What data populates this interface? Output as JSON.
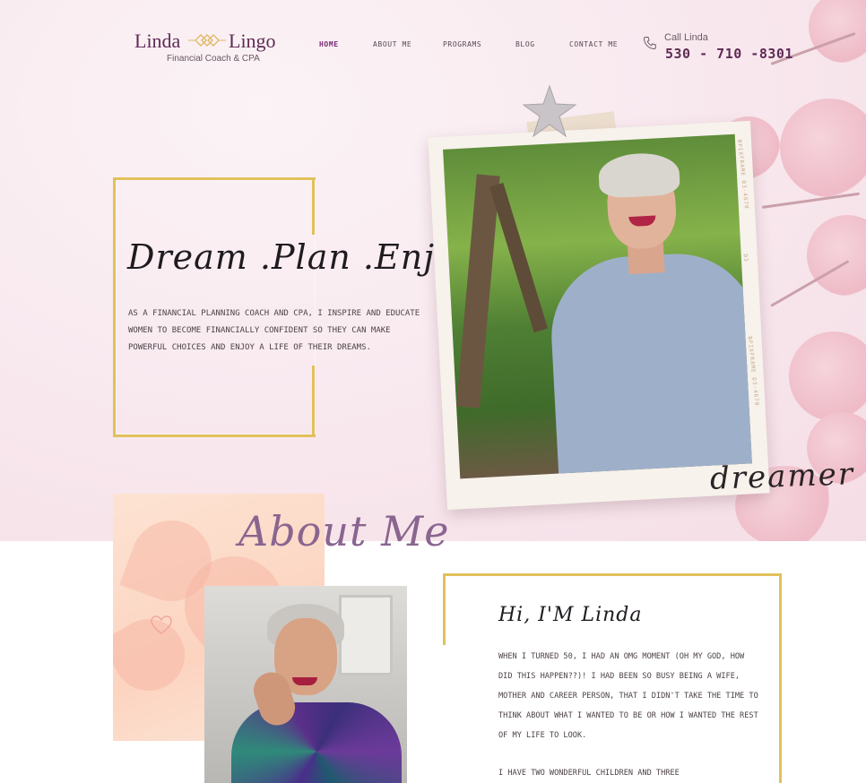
{
  "brand": {
    "name_first": "Linda",
    "name_last": "Lingo",
    "subtitle": "Financial Coach & CPA",
    "logo_icon": "interlocking-diamonds-icon",
    "accent_color": "#5e2b55",
    "gold_color": "#e2c15c"
  },
  "nav": {
    "items": [
      {
        "label": "HOME",
        "active": true
      },
      {
        "label": "ABOUT ME",
        "active": false
      },
      {
        "label": "PROGRAMS",
        "active": false
      },
      {
        "label": "BLOG",
        "active": false
      },
      {
        "label": "CONTACT ME",
        "active": false
      }
    ]
  },
  "contact": {
    "label": "Call Linda",
    "phone": "530 - 710 -8301",
    "icon": "phone-icon"
  },
  "hero": {
    "tagline": "Dream .Plan .Enjoy",
    "intro": "AS A FINANCIAL PLANNING COACH AND CPA, I INSPIRE AND EDUCATE WOMEN TO BECOME FINANCIALLY CONFIDENT SO THEY CAN MAKE POWERFUL CHOICES AND ENJOY A LIFE OF THEIR DREAMS.",
    "script_word": "dreamer",
    "film_text_1": "BPIXFRAME D3-4670",
    "film_text_2": "BPIXFRAME D3-4670",
    "film_text_3": "D3"
  },
  "about": {
    "title": "About Me",
    "greeting": "Hi, I'M Linda",
    "bio_1": "WHEN I TURNED 50, I HAD AN OMG MOMENT (OH MY GOD, HOW DID THIS HAPPEN??)! I HAD BEEN SO BUSY BEING A WIFE, MOTHER AND CAREER PERSON, THAT I DIDN'T TAKE THE TIME TO THINK ABOUT WHAT I WANTED TO BE OR HOW I WANTED THE REST OF MY LIFE TO LOOK.",
    "bio_2": "I HAVE TWO WONDERFUL CHILDREN AND THREE"
  }
}
